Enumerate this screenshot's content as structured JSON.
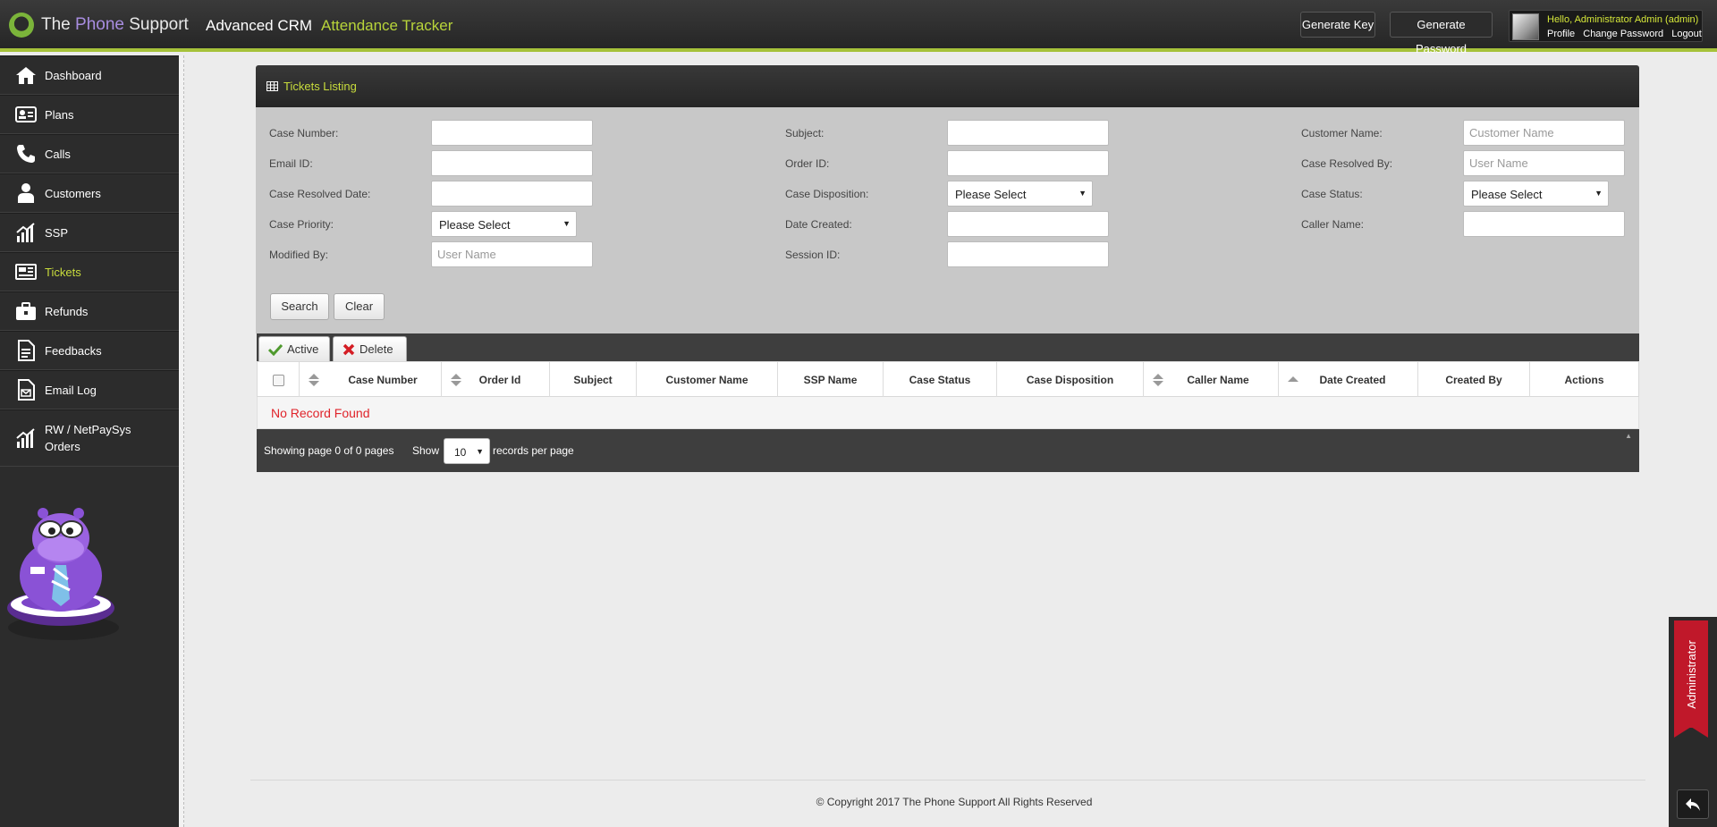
{
  "header": {
    "brand_part1": "The ",
    "brand_part2": "Phone",
    "brand_part3": " Support",
    "nav_crm": "Advanced CRM",
    "nav_attendance": "Attendance Tracker",
    "generate_key": "Generate Key",
    "generate_password": "Generate Password",
    "greeting": "Hello, Administrator Admin (admin)",
    "profile": "Profile",
    "change_password": "Change Password",
    "logout": "Logout"
  },
  "sidebar": {
    "items": [
      {
        "label": "Dashboard",
        "icon": "home-icon"
      },
      {
        "label": "Plans",
        "icon": "id-card-icon"
      },
      {
        "label": "Calls",
        "icon": "phone-icon"
      },
      {
        "label": "Customers",
        "icon": "user-icon"
      },
      {
        "label": "SSP",
        "icon": "bar-chart-icon"
      },
      {
        "label": "Tickets",
        "icon": "ticket-icon",
        "active": true
      },
      {
        "label": "Refunds",
        "icon": "briefcase-icon"
      },
      {
        "label": "Feedbacks",
        "icon": "document-icon"
      },
      {
        "label": "Email Log",
        "icon": "email-document-icon"
      },
      {
        "label": "RW / NetPaySys Orders",
        "icon": "bar-chart-icon"
      }
    ],
    "rw_line1": "RW / NetPaySys",
    "rw_line2": "Orders"
  },
  "panel": {
    "title": "Tickets Listing",
    "icon": "table-icon"
  },
  "filters": {
    "case_number": "Case Number:",
    "email_id": "Email ID:",
    "case_resolved_date": "Case Resolved Date:",
    "case_priority": "Case Priority:",
    "modified_by": "Modified By:",
    "subject": "Subject:",
    "order_id": "Order ID:",
    "case_disposition": "Case Disposition:",
    "date_created": "Date Created:",
    "session_id": "Session ID:",
    "customer_name": "Customer Name:",
    "case_resolved_by": "Case Resolved By:",
    "case_status": "Case Status:",
    "caller_name": "Caller Name:",
    "placeholder_customer_name": "Customer Name",
    "placeholder_user_name": "User Name",
    "please_select": "Please Select",
    "search": "Search",
    "clear": "Clear"
  },
  "toolbar": {
    "active": "Active",
    "delete": "Delete"
  },
  "table": {
    "columns": [
      "Case Number",
      "Order Id",
      "Subject",
      "Customer Name",
      "SSP Name",
      "Case Status",
      "Case Disposition",
      "Caller Name",
      "Date Created",
      "Created By",
      "Actions"
    ],
    "empty": "No Record Found"
  },
  "pager": {
    "info": "Showing page 0 of 0 pages",
    "show": "Show",
    "per_page_value": "10",
    "records_per_page": "records per page"
  },
  "footer": {
    "copyright": "© Copyright 2017 The Phone Support All Rights Reserved"
  },
  "admin_tab": {
    "label": "Administrator"
  },
  "colors": {
    "accent_green": "#a6c23a",
    "active_yellow": "#c8dc3c",
    "error_red": "#e0242b",
    "ribbon_red": "#c0182a"
  }
}
